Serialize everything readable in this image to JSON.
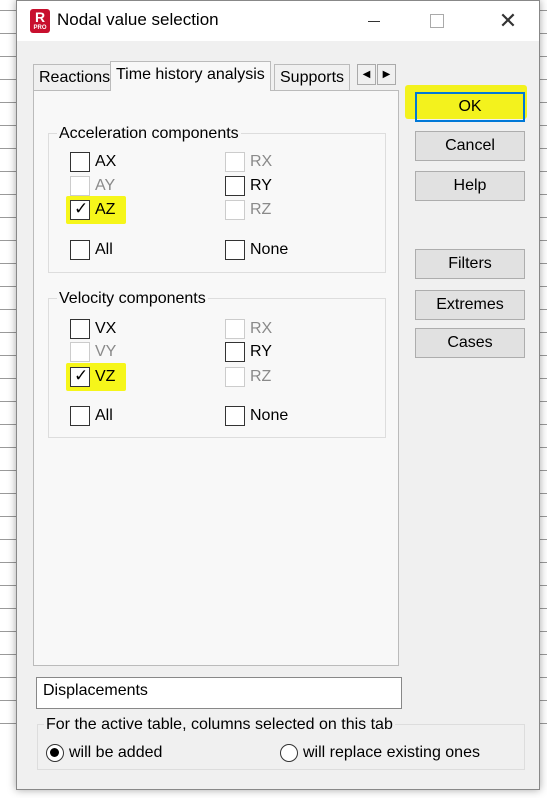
{
  "window": {
    "title": "Nodal value selection"
  },
  "tabs": [
    {
      "label": "Reactions"
    },
    {
      "label": "Time history analysis"
    },
    {
      "label": "Supports"
    }
  ],
  "acceleration": {
    "title": "Acceleration components",
    "items": [
      {
        "label": "AX",
        "checked": false,
        "enabled": true
      },
      {
        "label": "RX",
        "checked": false,
        "enabled": false
      },
      {
        "label": "AY",
        "checked": false,
        "enabled": false
      },
      {
        "label": "RY",
        "checked": false,
        "enabled": true
      },
      {
        "label": "AZ",
        "checked": true,
        "enabled": true
      },
      {
        "label": "RZ",
        "checked": false,
        "enabled": false
      }
    ],
    "all_label": "All",
    "none_label": "None"
  },
  "velocity": {
    "title": "Velocity components",
    "items": [
      {
        "label": "VX",
        "checked": false,
        "enabled": true
      },
      {
        "label": "RX",
        "checked": false,
        "enabled": false
      },
      {
        "label": "VY",
        "checked": false,
        "enabled": false
      },
      {
        "label": "RY",
        "checked": false,
        "enabled": true
      },
      {
        "label": "VZ",
        "checked": true,
        "enabled": true
      },
      {
        "label": "RZ",
        "checked": false,
        "enabled": false
      }
    ],
    "all_label": "All",
    "none_label": "None"
  },
  "buttons": {
    "ok": "OK",
    "cancel": "Cancel",
    "help": "Help",
    "filters": "Filters",
    "extremes": "Extremes",
    "cases": "Cases"
  },
  "table_name": "Displacements",
  "columns_group": {
    "title": "For the active table, columns selected on this tab",
    "option_add": "will be added",
    "option_replace": "will replace existing ones",
    "selected": "will be added"
  },
  "colors": {
    "highlight": "#f6f61a",
    "default_button_border": "#0078d7",
    "app_icon": "#c8102e"
  }
}
